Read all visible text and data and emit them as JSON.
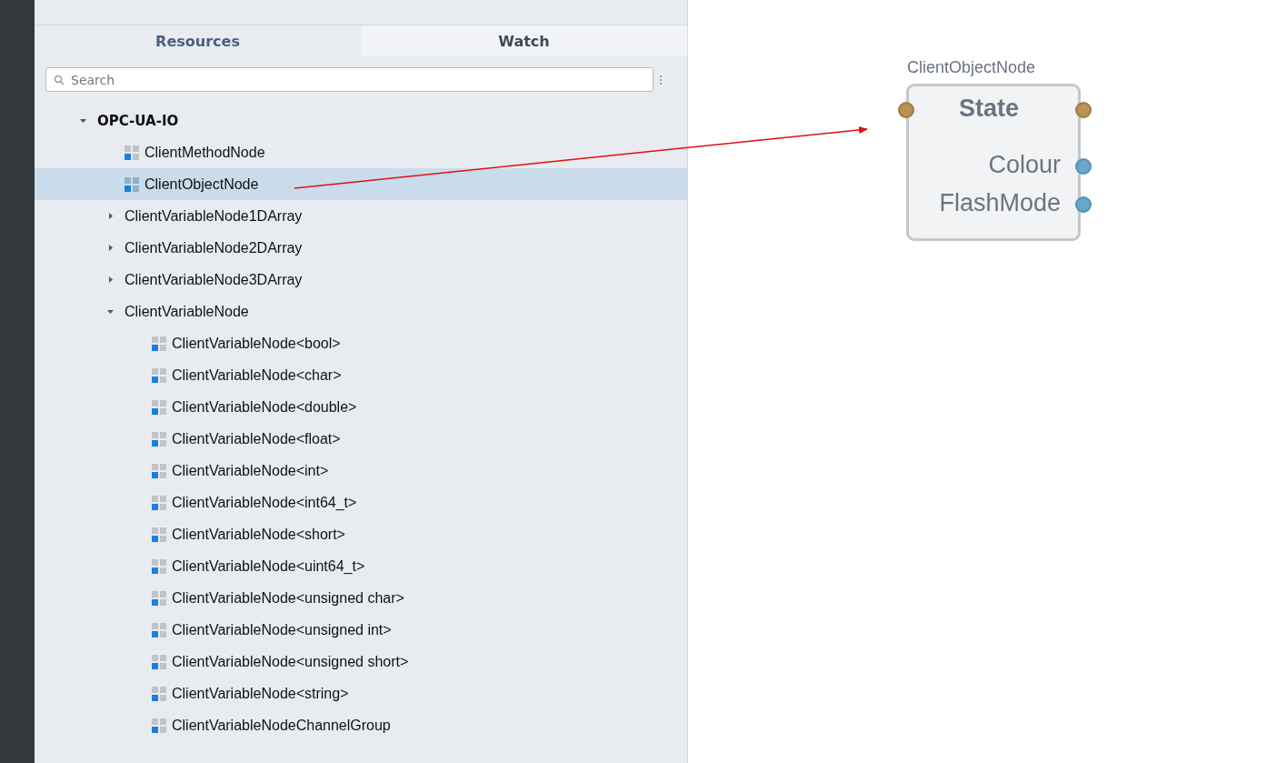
{
  "tabs": [
    {
      "label": "Resources",
      "selected": true
    },
    {
      "label": "Watch",
      "selected": false
    }
  ],
  "search": {
    "placeholder": "Search"
  },
  "tree": [
    {
      "label": "OPC-UA-IO",
      "kind": "folder",
      "expanded": true,
      "selected": false,
      "children": [
        {
          "label": "ClientMethodNode",
          "kind": "item",
          "selected": false
        },
        {
          "label": "ClientObjectNode",
          "kind": "item",
          "selected": true
        },
        {
          "label": "ClientVariableNode1DArray",
          "kind": "folder",
          "expanded": false,
          "selected": false
        },
        {
          "label": "ClientVariableNode2DArray",
          "kind": "folder",
          "expanded": false,
          "selected": false
        },
        {
          "label": "ClientVariableNode3DArray",
          "kind": "folder",
          "expanded": false,
          "selected": false
        },
        {
          "label": "ClientVariableNode",
          "kind": "folder",
          "expanded": true,
          "selected": false,
          "children": [
            {
              "label": "ClientVariableNode<bool>",
              "kind": "item",
              "selected": false
            },
            {
              "label": "ClientVariableNode<char>",
              "kind": "item",
              "selected": false
            },
            {
              "label": "ClientVariableNode<double>",
              "kind": "item",
              "selected": false
            },
            {
              "label": "ClientVariableNode<float>",
              "kind": "item",
              "selected": false
            },
            {
              "label": "ClientVariableNode<int>",
              "kind": "item",
              "selected": false
            },
            {
              "label": "ClientVariableNode<int64_t>",
              "kind": "item",
              "selected": false
            },
            {
              "label": "ClientVariableNode<short>",
              "kind": "item",
              "selected": false
            },
            {
              "label": "ClientVariableNode<uint64_t>",
              "kind": "item",
              "selected": false
            },
            {
              "label": "ClientVariableNode<unsigned char>",
              "kind": "item",
              "selected": false
            },
            {
              "label": "ClientVariableNode<unsigned int>",
              "kind": "item",
              "selected": false
            },
            {
              "label": "ClientVariableNode<unsigned short>",
              "kind": "item",
              "selected": false
            },
            {
              "label": "ClientVariableNode<string>",
              "kind": "item",
              "selected": false
            },
            {
              "label": "ClientVariableNodeChannelGroup",
              "kind": "item",
              "selected": false
            }
          ]
        }
      ]
    }
  ],
  "canvas_node": {
    "type_name": "ClientObjectNode",
    "header": "State",
    "header_ports": [
      {
        "kind": "event"
      },
      {
        "kind": "event"
      }
    ],
    "outputs": [
      {
        "label": "Colour",
        "kind": "data"
      },
      {
        "label": "FlashMode",
        "kind": "data"
      }
    ]
  }
}
